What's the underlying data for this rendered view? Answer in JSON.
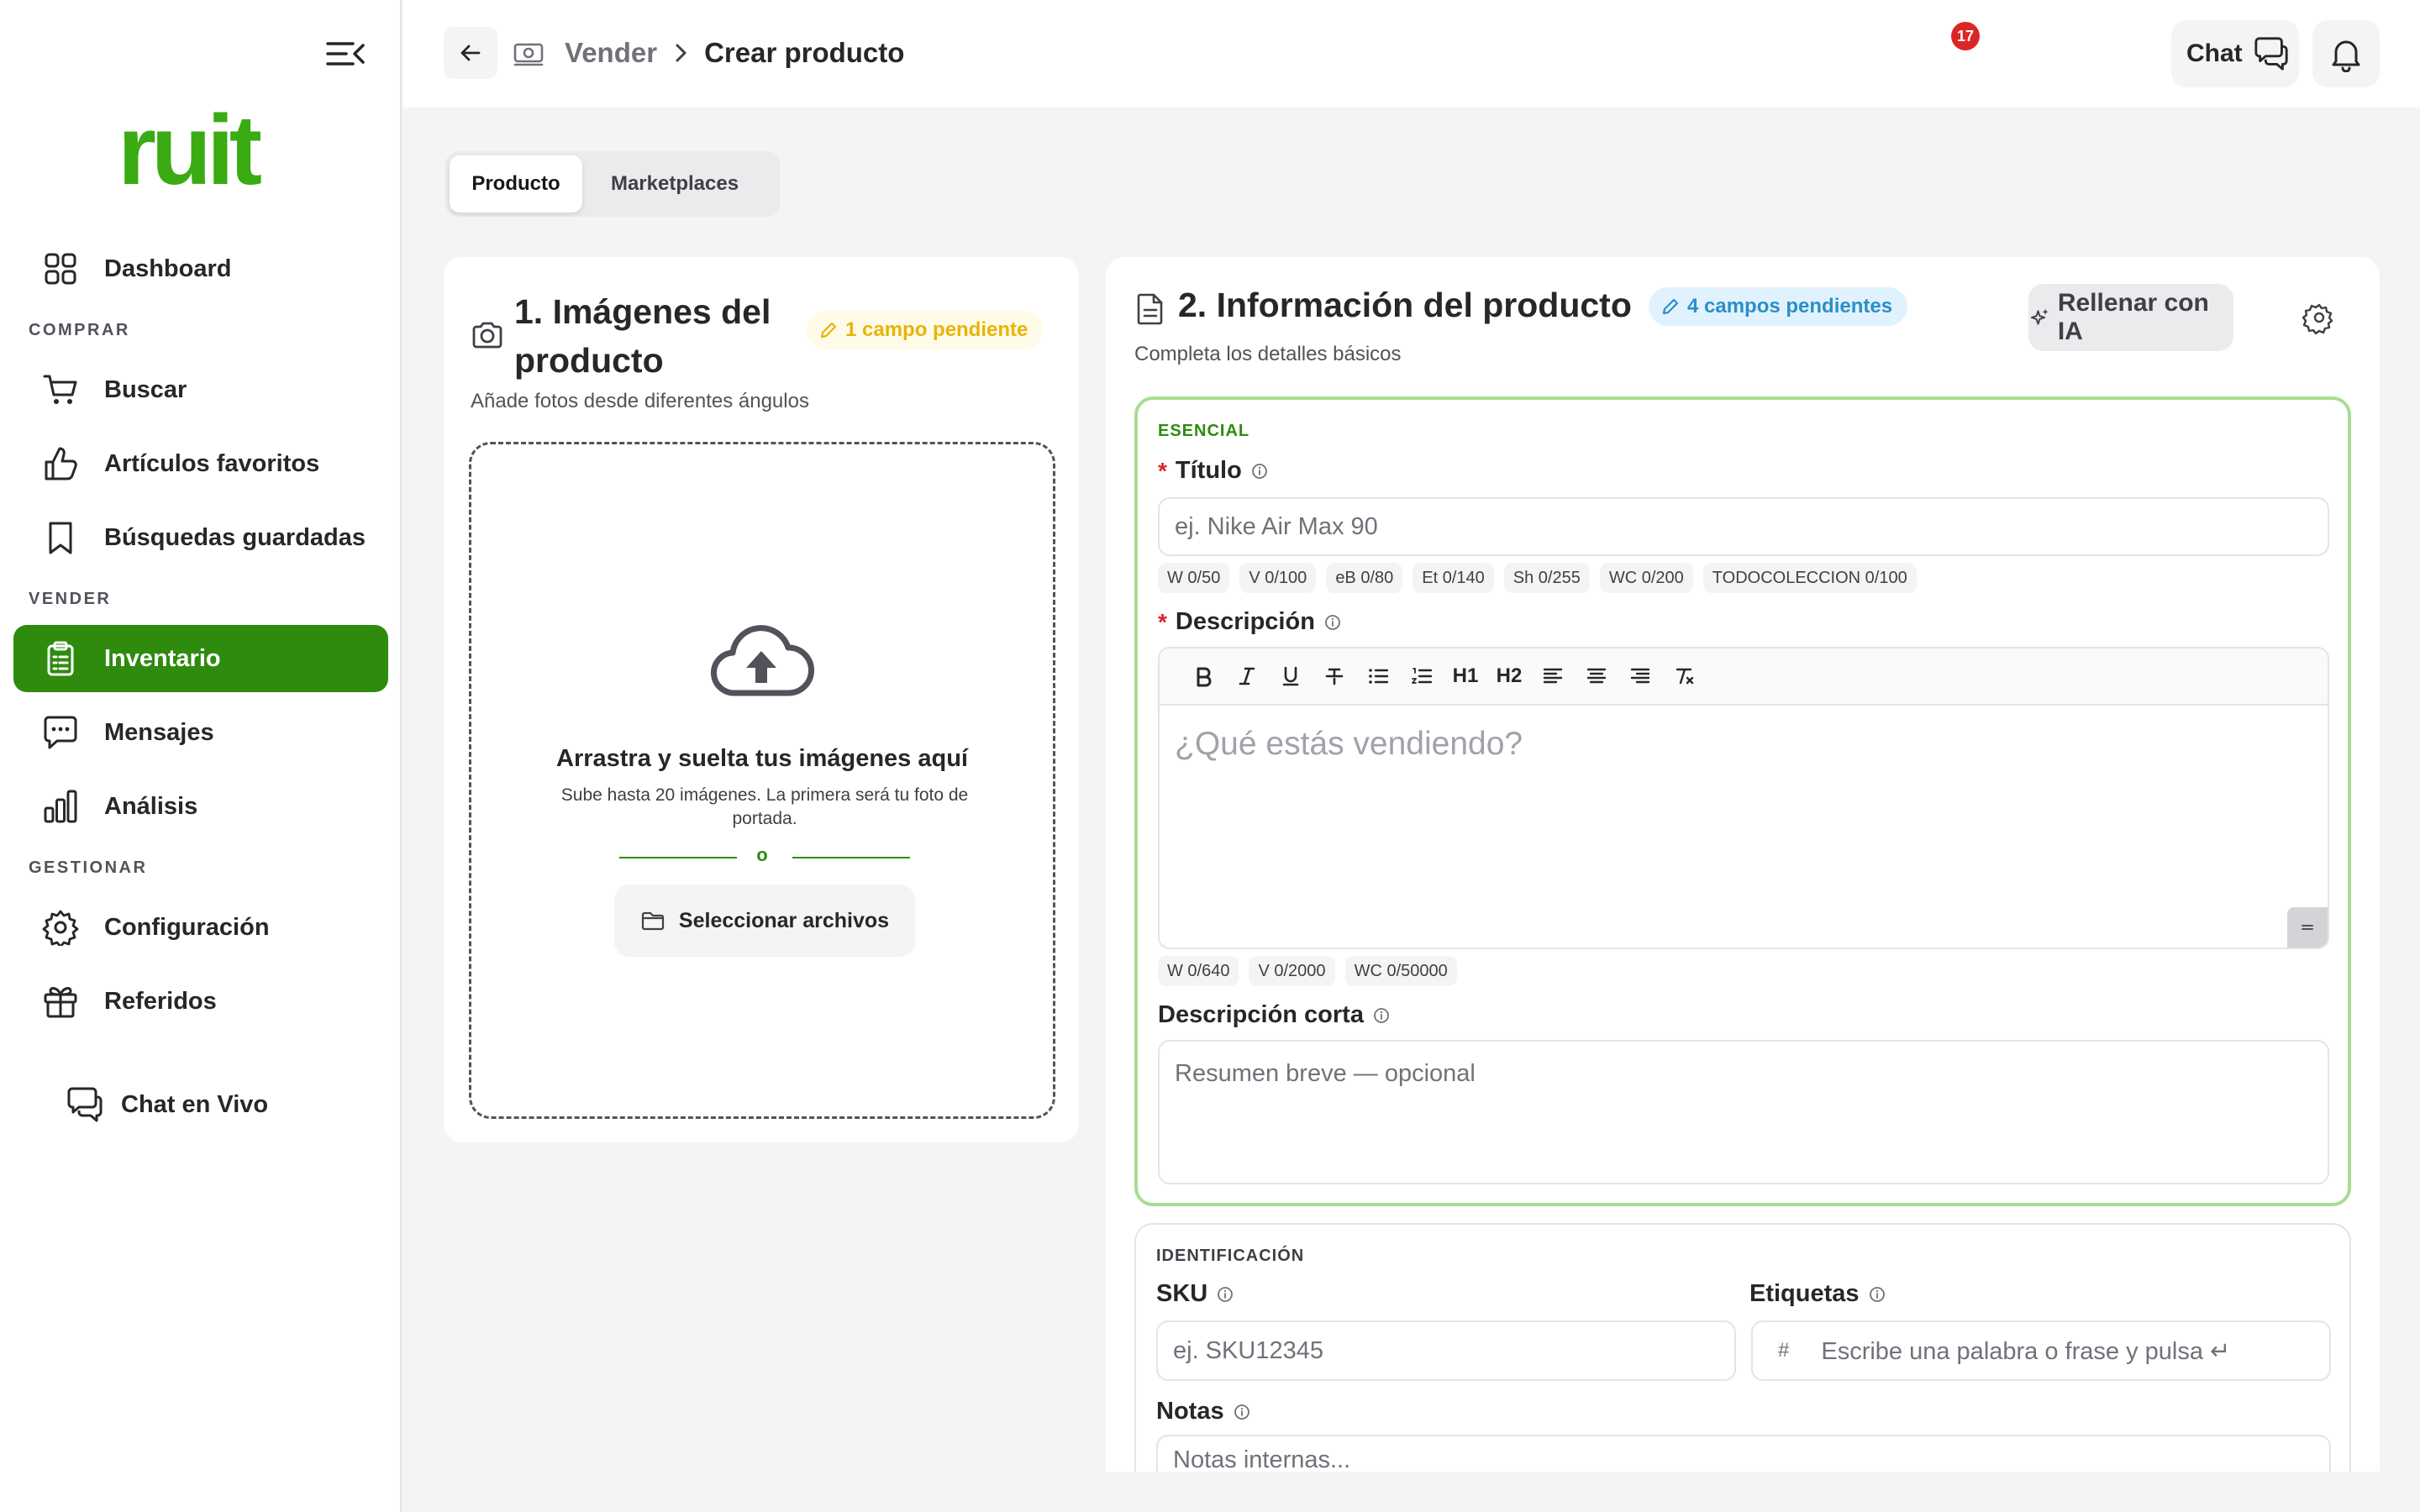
{
  "sidebar": {
    "logo": "ruit",
    "sections": {
      "comprar": "COMPRAR",
      "vender": "VENDER",
      "gestionar": "GESTIONAR"
    },
    "items": [
      {
        "label": "Dashboard",
        "icon": "grid-icon"
      },
      {
        "label": "Buscar",
        "icon": "cart-icon"
      },
      {
        "label": "Artículos favoritos",
        "icon": "thumbs-up-icon"
      },
      {
        "label": "Búsquedas guardadas",
        "icon": "bookmark-icon"
      },
      {
        "label": "Inventario",
        "icon": "clipboard-icon",
        "active": true
      },
      {
        "label": "Mensajes",
        "icon": "message-icon"
      },
      {
        "label": "Análisis",
        "icon": "bar-chart-icon"
      },
      {
        "label": "Configuración",
        "icon": "gear-icon"
      },
      {
        "label": "Referidos",
        "icon": "gift-icon"
      }
    ],
    "live_chat": "Chat en Vivo"
  },
  "header": {
    "breadcrumb": [
      "Vender",
      "Crear producto"
    ],
    "chat_label": "Chat",
    "notifications_count": "17"
  },
  "tabs": [
    {
      "label": "Producto",
      "active": true
    },
    {
      "label": "Marketplaces",
      "active": false
    }
  ],
  "images_card": {
    "title": "1. Imágenes del producto",
    "pending_badge": "1 campo pendiente",
    "subtitle": "Añade fotos desde diferentes ángulos",
    "dropzone": {
      "title": "Arrastra y suelta tus imágenes aquí",
      "subtitle": "Sube hasta 20 imágenes. La primera será tu foto de portada.",
      "or": "o",
      "select_button": "Seleccionar archivos"
    }
  },
  "info_card": {
    "title": "2. Información del producto",
    "pending_badge": "4 campos pendientes",
    "subtitle": "Completa los detalles básicos",
    "ai_button": "Rellenar con IA",
    "essential": {
      "label": "ESENCIAL",
      "title_field": {
        "label": "Título",
        "placeholder": "ej. Nike Air Max 90"
      },
      "title_counters": [
        "W 0/50",
        "V 0/100",
        "eB 0/80",
        "Et 0/140",
        "Sh 0/255",
        "WC 0/200",
        "TODOCOLECCION 0/100"
      ],
      "description_field": {
        "label": "Descripción",
        "placeholder": "¿Qué estás vendiendo?"
      },
      "toolbar": [
        "bold",
        "italic",
        "underline",
        "strikethrough",
        "bullet-list",
        "numbered-list",
        "H1",
        "H2",
        "align-left",
        "align-center",
        "align-right",
        "clear-format"
      ],
      "description_counters": [
        "W 0/640",
        "V 0/2000",
        "WC 0/50000"
      ],
      "short_description": {
        "label": "Descripción corta",
        "placeholder": "Resumen breve — opcional"
      }
    },
    "identification": {
      "label": "IDENTIFICACIÓN",
      "sku": {
        "label": "SKU",
        "placeholder": "ej. SKU12345"
      },
      "tags": {
        "label": "Etiquetas",
        "prefix": "#",
        "placeholder": "Escribe una palabra o frase y pulsa ↵"
      },
      "notes": {
        "label": "Notas",
        "placeholder": "Notas internas..."
      }
    }
  },
  "colors": {
    "brand": "#3aab12",
    "active_nav": "#2e8b0e",
    "essential_border": "#a7dd92",
    "badge_red": "#dc2626",
    "pending_yellow": "#eab308",
    "pending_blue": "#2b8ec8"
  }
}
